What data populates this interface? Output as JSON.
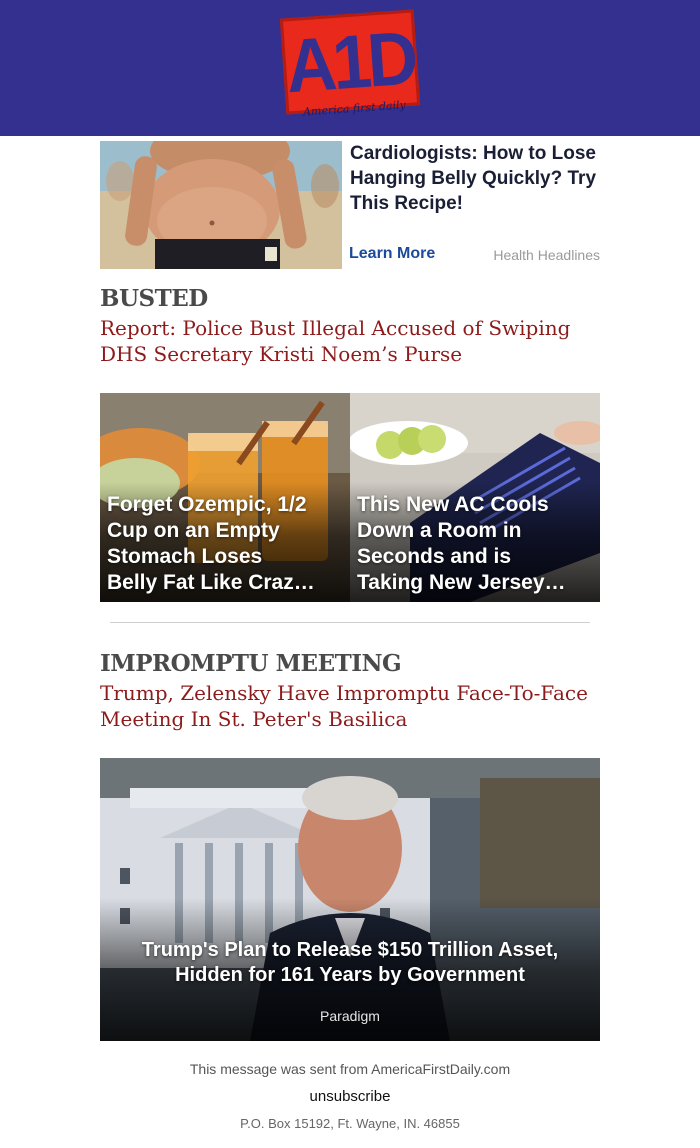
{
  "header": {
    "logo_text": "A1D",
    "logo_tagline": "America first daily",
    "brand_color": "#333090",
    "logo_color": "#e8291c"
  },
  "ad_top": {
    "title": "Cardiologists: How to Lose Hanging Belly Quickly? Try This Recipe!",
    "cta": "Learn More",
    "source": "Health Headlines"
  },
  "stories": [
    {
      "kicker": "BUSTED",
      "headline": "Report: Police Bust Illegal Accused of Swiping DHS Secretary Kristi Noem’s Purse"
    },
    {
      "kicker": "IMPROMPTU MEETING",
      "headline": "Trump, Zelensky Have Impromptu Face-To-Face Meeting In St. Peter's Basilica"
    }
  ],
  "ad_tiles": [
    {
      "label": "Forget Ozempic, 1/2\nCup on an Empty\nStomach Loses\nBelly Fat Like Craz…"
    },
    {
      "label": "This New AC Cools\nDown a Room in\nSeconds and is\nTaking New Jersey…"
    }
  ],
  "promo": {
    "title": "Trump's Plan to Release $150 Trillion Asset, Hidden for 161 Years by Government",
    "source": "Paradigm"
  },
  "footer": {
    "sent_from": "This message was sent from AmericaFirstDaily.com",
    "unsubscribe": "unsubscribe",
    "address": "P.O. Box 15192, Ft. Wayne, IN. 46855"
  }
}
